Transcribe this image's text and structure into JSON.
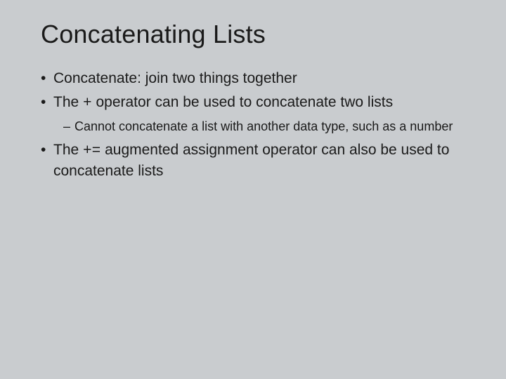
{
  "slide": {
    "title": "Concatenating Lists",
    "bullets": [
      {
        "text": "Concatenate: join two things together"
      },
      {
        "prefix": "The ",
        "code": "+",
        "suffix": " operator can be used to concatenate two lists",
        "sub": [
          {
            "text": "Cannot concatenate a list with another data type, such as a number"
          }
        ]
      },
      {
        "prefix": "The ",
        "code": "+=",
        "suffix": " augmented assignment operator can also be used to concatenate lists"
      }
    ]
  }
}
